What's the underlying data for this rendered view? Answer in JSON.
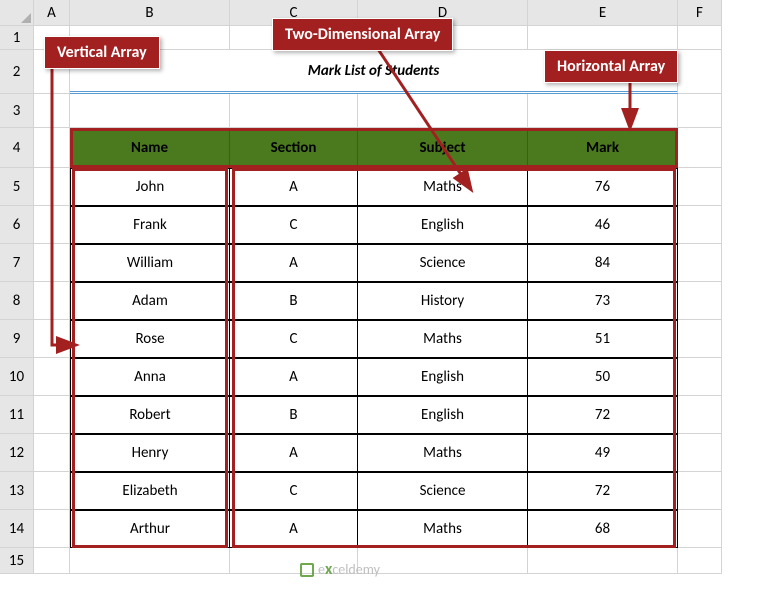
{
  "columns": [
    "A",
    "B",
    "C",
    "D",
    "E",
    "F"
  ],
  "rows": [
    "1",
    "2",
    "3",
    "4",
    "5",
    "6",
    "7",
    "8",
    "9",
    "10",
    "11",
    "12",
    "13",
    "14",
    "15"
  ],
  "title": "Mark List of Students",
  "headers": {
    "name": "Name",
    "section": "Section",
    "subject": "Subject",
    "mark": "Mark"
  },
  "callouts": {
    "vertical": "Vertical Array",
    "two_d": "Two-Dimensional Array",
    "horizontal": "Horizontal Array"
  },
  "watermark": {
    "prefix": "e",
    "x": "x",
    "suffix": "celdemy"
  },
  "chart_data": {
    "type": "table",
    "title": "Mark List of Students",
    "columns": [
      "Name",
      "Section",
      "Subject",
      "Mark"
    ],
    "data": [
      {
        "name": "John",
        "section": "A",
        "subject": "Maths",
        "mark": 76
      },
      {
        "name": "Frank",
        "section": "C",
        "subject": "English",
        "mark": 46
      },
      {
        "name": "William",
        "section": "A",
        "subject": "Science",
        "mark": 84
      },
      {
        "name": "Adam",
        "section": "B",
        "subject": "History",
        "mark": 73
      },
      {
        "name": "Rose",
        "section": "C",
        "subject": "Maths",
        "mark": 51
      },
      {
        "name": "Anna",
        "section": "A",
        "subject": "English",
        "mark": 50
      },
      {
        "name": "Robert",
        "section": "B",
        "subject": "English",
        "mark": 72
      },
      {
        "name": "Henry",
        "section": "A",
        "subject": "Maths",
        "mark": 49
      },
      {
        "name": "Elizabeth",
        "section": "C",
        "subject": "Science",
        "mark": 72
      },
      {
        "name": "Arthur",
        "section": "A",
        "subject": "Maths",
        "mark": 68
      }
    ],
    "annotations": {
      "vertical_array": "Name column (B5:B14)",
      "two_dimensional_array": "Section/Subject/Mark block (C5:E14)",
      "horizontal_array": "Header row (B4:E4)"
    }
  }
}
